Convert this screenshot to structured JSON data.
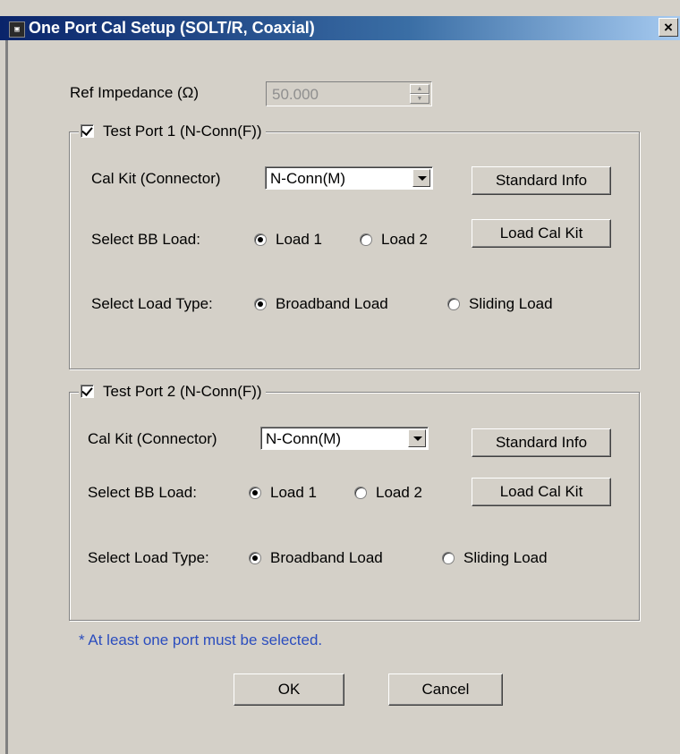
{
  "window": {
    "title": "One Port Cal Setup (SOLT/R, Coaxial)",
    "close_glyph": "×"
  },
  "ref_impedance": {
    "label": "Ref Impedance (Ω)",
    "value": "50.000"
  },
  "port1": {
    "title": "Test Port 1 (N-Conn(F))",
    "checked": true,
    "cal_kit_label": "Cal Kit (Connector)",
    "cal_kit_value": "N-Conn(M)",
    "standard_info_label": "Standard Info",
    "bb_load_label": "Select BB Load:",
    "load1_label": "Load 1",
    "load2_label": "Load 2",
    "load_cal_kit_label": "Load Cal Kit",
    "load_type_label": "Select Load Type:",
    "broadband_label": "Broadband Load",
    "sliding_label": "Sliding Load"
  },
  "port2": {
    "title": "Test Port 2 (N-Conn(F))",
    "checked": true,
    "cal_kit_label": "Cal Kit (Connector)",
    "cal_kit_value": "N-Conn(M)",
    "standard_info_label": "Standard Info",
    "bb_load_label": "Select BB Load:",
    "load1_label": "Load 1",
    "load2_label": "Load 2",
    "load_cal_kit_label": "Load Cal Kit",
    "load_type_label": "Select Load Type:",
    "broadband_label": "Broadband Load",
    "sliding_label": "Sliding Load"
  },
  "note": "* At least one port must be selected.",
  "buttons": {
    "ok": "OK",
    "cancel": "Cancel"
  },
  "colors": {
    "note_text": "#2b4dbe",
    "title_bar": "#0a246a"
  }
}
